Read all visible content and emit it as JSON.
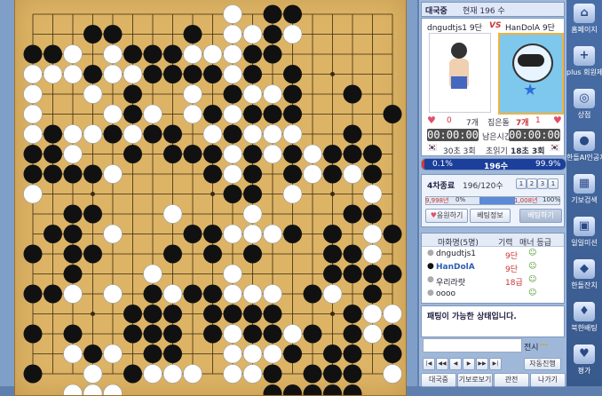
{
  "game": {
    "title": "대국중",
    "move_info": "현재 196 수"
  },
  "players": {
    "left_name": "dngudtjs1 9단",
    "vs": "VS",
    "right_name": "HanDolA 9단",
    "left_captures": "0",
    "left_lost": "7개",
    "center_label": "집은돌",
    "right_lost": "7개",
    "right_captures": "1",
    "left_time": "00:00:00",
    "time_label": "남은시간",
    "right_time": "00:00:00",
    "left_byoyomi": "30초 3회",
    "byoyomi_label": "초읽기",
    "right_byoyomi": "18초 3회"
  },
  "winrate": {
    "left": "0.1%",
    "center": "196수",
    "right": "99.9%",
    "fraction": 0.001
  },
  "tabs": {
    "active": "4차종료",
    "moves": "196/120수",
    "pages": [
      "1",
      "2",
      "3",
      "1"
    ]
  },
  "progress": {
    "left": "9,998년",
    "pct": "0%",
    "right": "1,008년",
    "right_pct": "100%"
  },
  "buttons": {
    "cheer": "응원하기",
    "bet": "베팅정보",
    "disabled": "베팅하기"
  },
  "list": {
    "headers": [
      "마화명(5명)",
      "기력",
      "매너 등급"
    ],
    "rows": [
      [
        "dngudtjs1",
        "9단",
        ""
      ],
      [
        "HanDolA",
        "9단",
        ""
      ],
      [
        "우리라랏",
        "18급",
        ""
      ],
      [
        "oooo",
        "",
        ""
      ]
    ]
  },
  "chat": {
    "message": "패팅이 가능한 상태입니다.",
    "send": "전시"
  },
  "bottom": {
    "auto": "자동진행",
    "buttons": [
      "대국중",
      "기보로보기",
      "관전",
      "나가기"
    ]
  },
  "sidebar": {
    "items": [
      "홈페이지",
      "plus 회원제",
      "상점",
      "한돌AI인공지능",
      "기보검색",
      "일일미션",
      "한돌잔치",
      "북한배팅",
      "평가"
    ]
  },
  "colors": {
    "board": "#ddb466",
    "black": "#111111",
    "white": "#ffffff",
    "accent": "#2d5fb0"
  },
  "board_rows": [
    "..........W.BB.....",
    "...BB...B.WWBW.....",
    "BBW.WBBBWWWBB......",
    "WWWBWWBBBBWB.B.....",
    "W..W.B..W.BWWB..B..",
    "W...WBW.WBWBBB....B",
    "WBWWBWBB.WBWWW..B..",
    "BBW..B.BBBWBWBWBBB.",
    "BBBBW....BWB.BWBWB.",
    "W.........BB.W...W.",
    "..BB...W...W....BB.",
    ".BB.W...BBWWWB.B.WB",
    "B.BB...B.B.B...BBW.",
    "..B...W...W....BBBB",
    "BBW.W.BWBBWWW.BW.B.",
    ".....BBB.BBBB...BWW",
    "B.B..BBB.BWBBWB.BWB",
    "..WBW.BB..WWWB.BB.B",
    "B..W.BWWW.WWB.BBB.W",
    "..WWW.......BBBBB.."
  ]
}
